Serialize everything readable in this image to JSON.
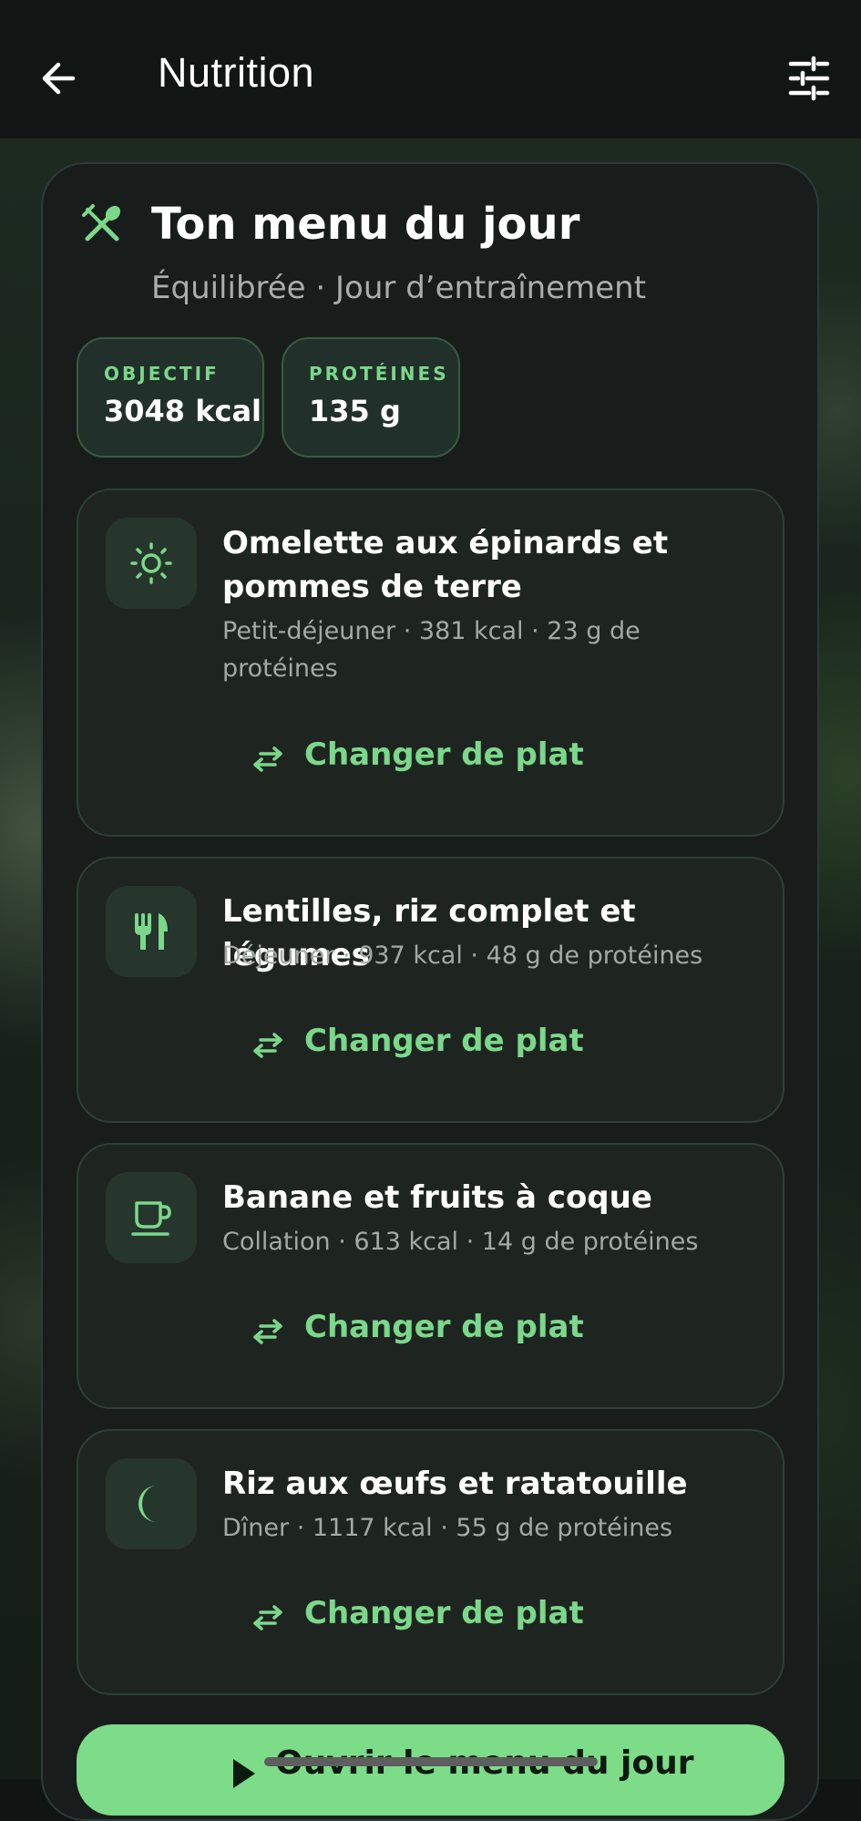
{
  "app": {
    "title": "Nutrition"
  },
  "header": {
    "back_icon": "arrow-left-icon",
    "filter_icon": "sliders-icon"
  },
  "menu": {
    "title": "Ton menu du jour",
    "subtitle": "Équilibrée · Jour d’entraînement",
    "icon": "utensils-crossed-icon"
  },
  "stats": [
    {
      "label": "OBJECTIF",
      "value": "3048 kcal"
    },
    {
      "label": "PROTÉINES",
      "value": "135 g"
    }
  ],
  "meals": [
    {
      "icon": "sun-icon",
      "title": "Omelette aux épinards et pommes de terre",
      "meta": "Petit-déjeuner · 381 kcal · 23 g de protéines",
      "swap_label": "Changer de plat"
    },
    {
      "icon": "fork-knife-icon",
      "title": "Lentilles, riz complet et légumes",
      "meta": "Déjeuner · 937 kcal · 48 g de protéines",
      "swap_label": "Changer de plat"
    },
    {
      "icon": "cup-icon",
      "title": "Banane et fruits à coque",
      "meta": "Collation · 613 kcal · 14 g de protéines",
      "swap_label": "Changer de plat"
    },
    {
      "icon": "moon-icon",
      "title": "Riz aux œufs et ratatouille",
      "meta": "Dîner · 1117 kcal · 55 g de protéines",
      "swap_label": "Changer de plat"
    }
  ],
  "cta": {
    "label": "Ouvrir le menu du jour",
    "icon": "play-icon"
  },
  "colors": {
    "accent": "#7bd88a",
    "background": "#101513",
    "card": "#1e2521"
  }
}
